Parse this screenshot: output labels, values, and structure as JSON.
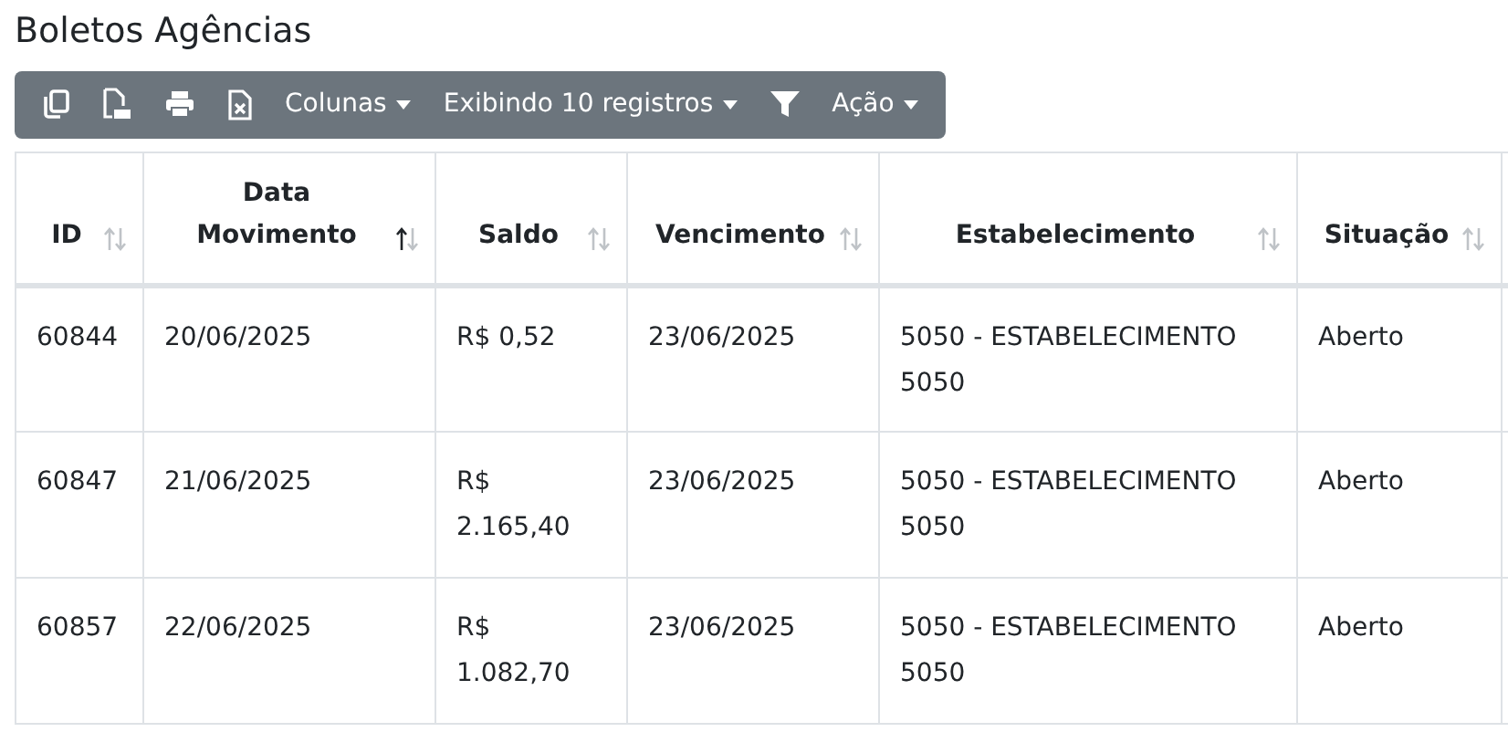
{
  "page_title": "Boletos Agências",
  "toolbar": [
    {
      "kind": "copy"
    },
    {
      "kind": "pdf"
    },
    {
      "kind": "print"
    },
    {
      "kind": "excel"
    },
    {
      "kind": "dropdown",
      "label": "Colunas"
    },
    {
      "kind": "dropdown",
      "label": "Exibindo 10 registros"
    },
    {
      "kind": "filter"
    },
    {
      "kind": "dropdown",
      "label": "Ação"
    }
  ],
  "table": {
    "columns": [
      {
        "label": "ID",
        "sorted": false
      },
      {
        "label": "Data Movimento",
        "sorted": true
      },
      {
        "label": "Saldo",
        "sorted": false
      },
      {
        "label": "Vencimento",
        "sorted": false
      },
      {
        "label": "Estabelecimento",
        "sorted": false
      },
      {
        "label": "Situação",
        "sorted": false
      }
    ],
    "rows": [
      [
        "60844",
        "20/06/2025",
        "R$ 0,52",
        "23/06/2025",
        "5050 - ESTABELECIMENTO 5050",
        "Aberto"
      ],
      [
        "60847",
        "21/06/2025",
        "R$ 2.165,40",
        "23/06/2025",
        "5050 - ESTABELECIMENTO 5050",
        "Aberto"
      ],
      [
        "60857",
        "22/06/2025",
        "R$ 1.082,70",
        "23/06/2025",
        "5050 - ESTABELECIMENTO 5050",
        "Aberto"
      ]
    ]
  }
}
